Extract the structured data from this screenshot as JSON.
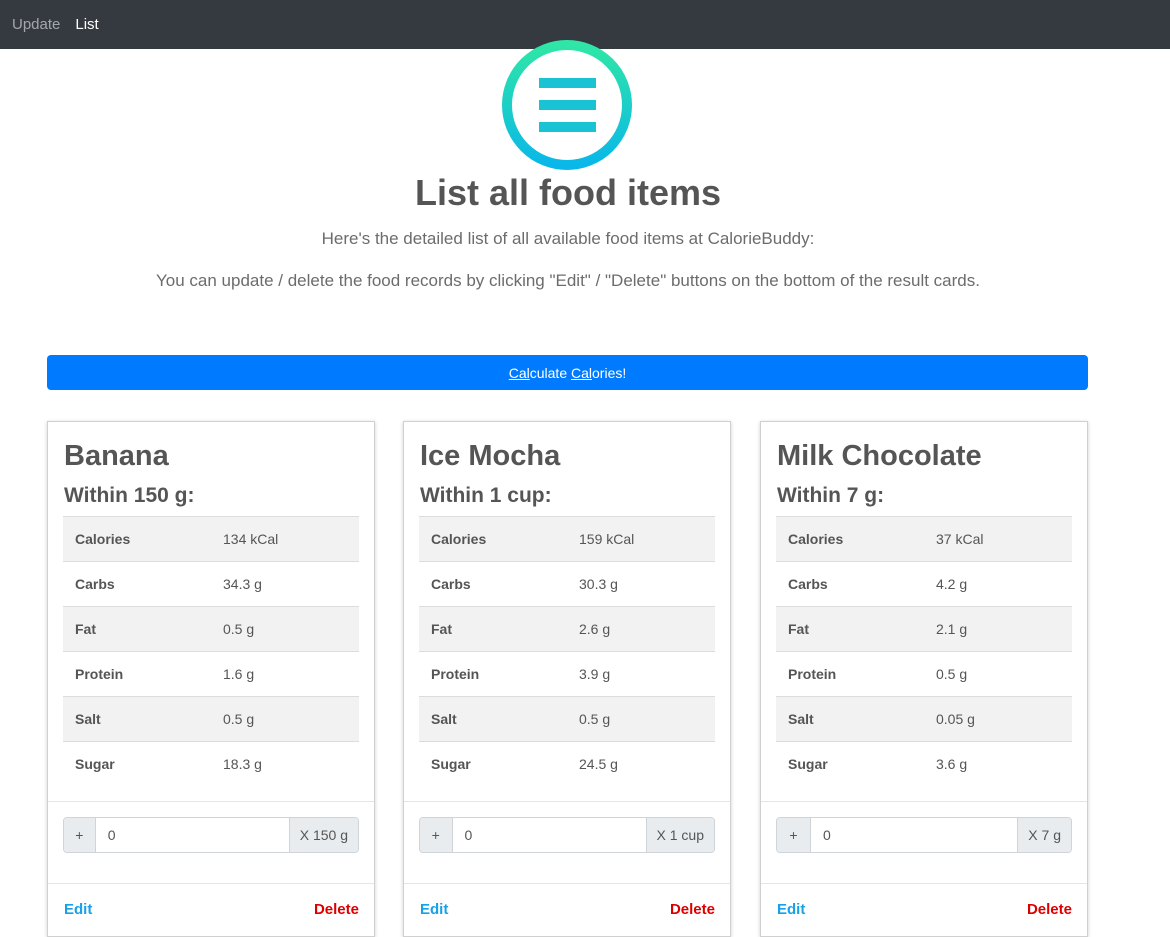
{
  "nav": {
    "items": [
      "Update",
      "List"
    ],
    "active": 1
  },
  "logo": {
    "icon": "menu-icon",
    "ring_colors": [
      "#2fe6a6",
      "#09b8e8"
    ],
    "bar_color": "#19c3d4"
  },
  "header": {
    "title": "List all food items",
    "subtitle": "Here's the detailed list of all available food items at CalorieBuddy:",
    "instructions": "You can update / delete the food records by clicking \"Edit\" / \"Delete\" buttons on the bottom of the result cards."
  },
  "calculate_button": {
    "parts": [
      "Cal",
      "culate ",
      "Cal",
      "ories!"
    ]
  },
  "colors": {
    "primary": "#007bff",
    "navbar": "#343a40",
    "edit": "#17a2e8",
    "delete": "#dc0000"
  },
  "cards": [
    {
      "name": "Banana",
      "portion": "Within 150 g:",
      "rows": [
        {
          "label": "Calories",
          "value": "134 kCal"
        },
        {
          "label": "Carbs",
          "value": "34.3 g"
        },
        {
          "label": "Fat",
          "value": "0.5 g"
        },
        {
          "label": "Protein",
          "value": "1.6 g"
        },
        {
          "label": "Salt",
          "value": "0.5 g"
        },
        {
          "label": "Sugar",
          "value": "18.3 g"
        }
      ],
      "plus": "+",
      "quantity": "0",
      "unit": "X 150 g",
      "edit": "Edit",
      "delete": "Delete"
    },
    {
      "name": "Ice Mocha",
      "portion": "Within 1 cup:",
      "rows": [
        {
          "label": "Calories",
          "value": "159 kCal"
        },
        {
          "label": "Carbs",
          "value": "30.3 g"
        },
        {
          "label": "Fat",
          "value": "2.6 g"
        },
        {
          "label": "Protein",
          "value": "3.9 g"
        },
        {
          "label": "Salt",
          "value": "0.5 g"
        },
        {
          "label": "Sugar",
          "value": "24.5 g"
        }
      ],
      "plus": "+",
      "quantity": "0",
      "unit": "X 1 cup",
      "edit": "Edit",
      "delete": "Delete"
    },
    {
      "name": "Milk Chocolate",
      "portion": "Within 7 g:",
      "rows": [
        {
          "label": "Calories",
          "value": "37 kCal"
        },
        {
          "label": "Carbs",
          "value": "4.2 g"
        },
        {
          "label": "Fat",
          "value": "2.1 g"
        },
        {
          "label": "Protein",
          "value": "0.5 g"
        },
        {
          "label": "Salt",
          "value": "0.05 g"
        },
        {
          "label": "Sugar",
          "value": "3.6 g"
        }
      ],
      "plus": "+",
      "quantity": "0",
      "unit": "X 7 g",
      "edit": "Edit",
      "delete": "Delete"
    }
  ]
}
